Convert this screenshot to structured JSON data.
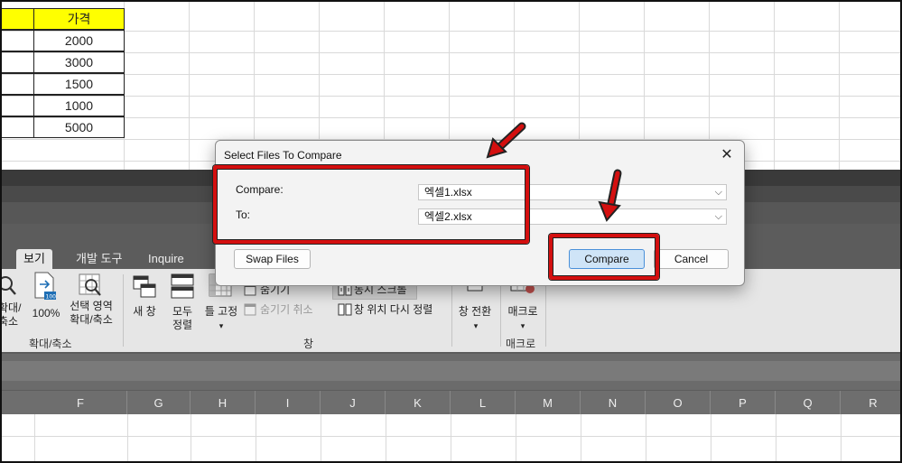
{
  "top_sheet": {
    "header": "가격",
    "values": [
      "2000",
      "3000",
      "1500",
      "1000",
      "5000"
    ]
  },
  "excel": {
    "tabs": [
      {
        "label": "보기",
        "active": true
      },
      {
        "label": "개발 도구",
        "active": false
      },
      {
        "label": "Inquire",
        "active": false
      }
    ],
    "ribbon": {
      "zoom_partial": "확대/\n축소",
      "zoom_100": "100%",
      "zoom_selection": "선택 영역\n확대/축소",
      "group_zoom": "확대/축소",
      "new_window": "새 창",
      "arrange_all": "모두\n정렬",
      "freeze_panes": "틀 고정",
      "hide": "숨기기",
      "unhide": "숨기기 취소",
      "sync_scroll": "동시 스크롤",
      "reset_position": "창 위치 다시 정렬",
      "switch_windows": "창 전환",
      "group_window": "창",
      "macros": "매크로",
      "group_macros": "매크로",
      "badge_100": "100"
    },
    "column_headers": [
      "F",
      "G",
      "H",
      "I",
      "J",
      "K",
      "L",
      "M",
      "N",
      "O",
      "P",
      "Q",
      "R"
    ]
  },
  "dialog": {
    "title": "Select Files To Compare",
    "compare_label": "Compare:",
    "compare_value": "엑셀1.xlsx",
    "to_label": "To:",
    "to_value": "엑셀2.xlsx",
    "swap_button": "Swap Files",
    "compare_button": "Compare",
    "cancel_button": "Cancel",
    "close_glyph": "✕"
  },
  "colors": {
    "highlight": "#d40f0f",
    "header_fill": "#ffff00",
    "primary_button": "#cfe4f7"
  }
}
